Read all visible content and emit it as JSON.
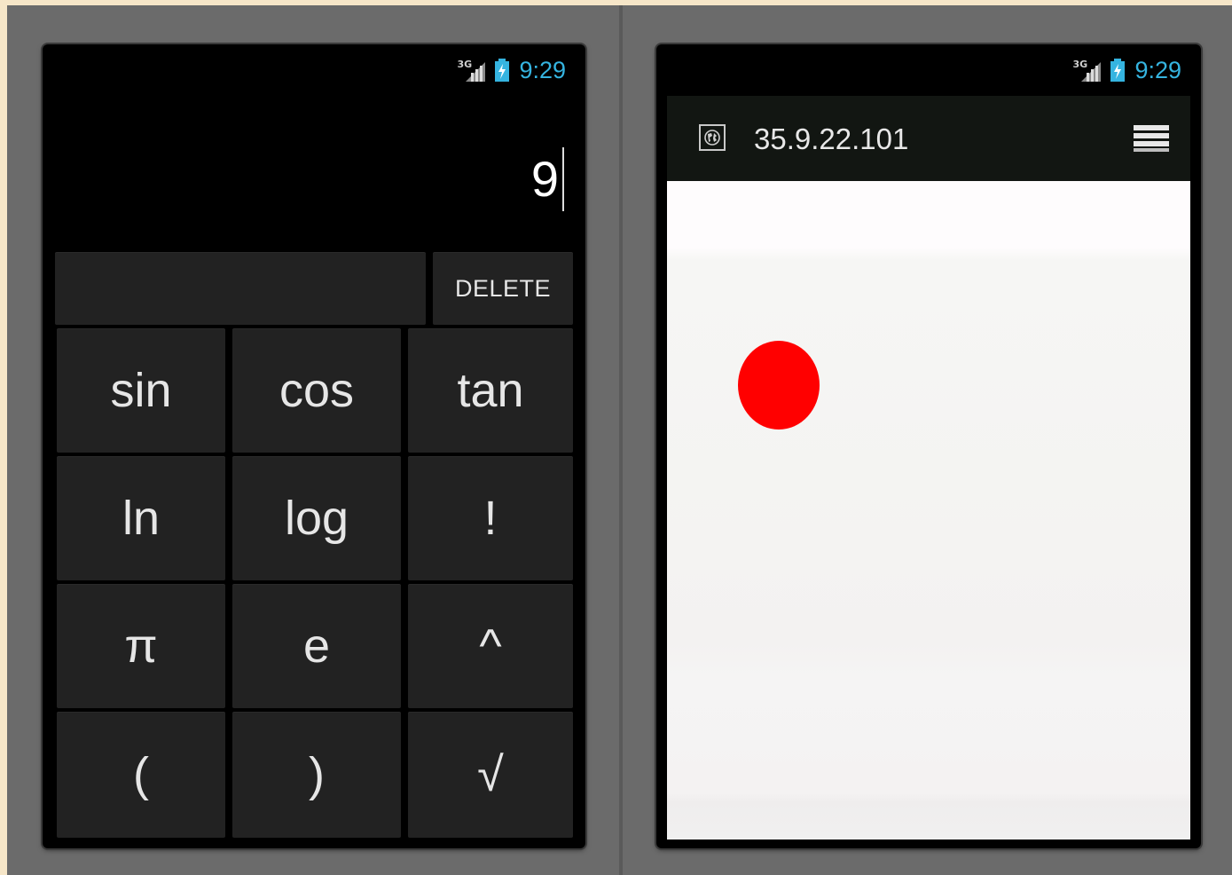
{
  "status_bar": {
    "network": "3G",
    "time": "9:29"
  },
  "calculator": {
    "display": "9",
    "delete_label": "DELETE",
    "keys": [
      "sin",
      "cos",
      "tan",
      "ln",
      "log",
      "!",
      "π",
      "e",
      "^",
      "(",
      ")",
      "√"
    ]
  },
  "browser": {
    "url": "35.9.22.101",
    "icons": {
      "site": "globe-icon",
      "menu": "menu-icon"
    },
    "dot_color": "#ff0000"
  },
  "colors": {
    "clock": "#35b4e0",
    "key_bg": "#222222",
    "phone_bg": "#000000"
  }
}
